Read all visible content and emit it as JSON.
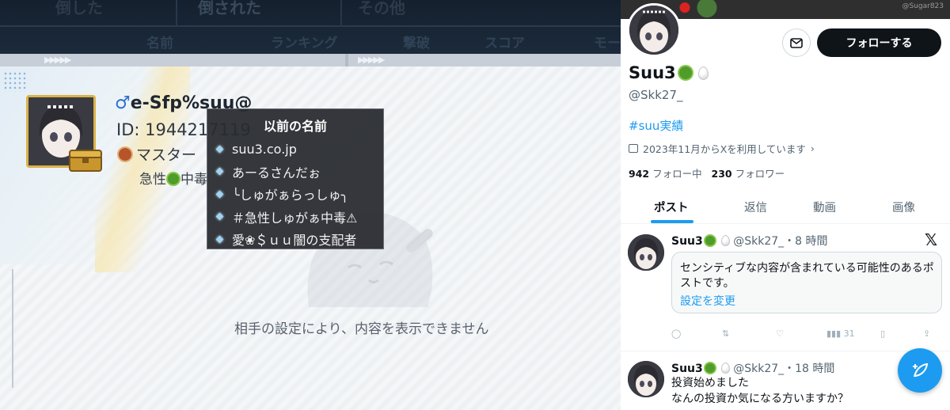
{
  "game": {
    "top_tabs": [
      "倒した",
      "倒された",
      "その他"
    ],
    "columns": [
      "名前",
      "ランキング",
      "撃破",
      "スコア",
      "モー"
    ],
    "player": {
      "name": "e-Sfp%suu@",
      "gender_symbol": "♂",
      "id": "ID: 1944217119",
      "rank": "マスター",
      "status_before": "急性",
      "status_after": "中毒"
    },
    "hidden_message": "相手の設定により、内容を表示できません",
    "tooltip": {
      "title": "以前の名前",
      "items": [
        "suu3.co.jp",
        "あーるさんだぉ",
        "╰しゅがぁらっしゅ╮",
        "＃急性しゅがぁ中毒⚠",
        "愛❀＄ｕｕ闇の支配者"
      ]
    }
  },
  "social": {
    "banner_watermark": "@Sugar823",
    "follow_label": "フォローする",
    "display_name": "Suu3",
    "handle": "@Skk27_",
    "hashtag": "#suu実績",
    "joined": "2023年11月からXを利用しています",
    "following_count": "942",
    "following_label": "フォロー中",
    "followers_count": "230",
    "followers_label": "フォロワー",
    "tabs": [
      "ポスト",
      "返信",
      "動画",
      "画像"
    ],
    "post1": {
      "name": "Suu3",
      "handle": "@Skk27_",
      "time": "・8 時間",
      "sensitive_text": "センシティブな内容が含まれている可能性のあるポストです。",
      "settings_link": "設定を変更",
      "views": "31"
    },
    "post2": {
      "name": "Suu3",
      "handle": "@Skk27_",
      "time": "・18 時間",
      "line1": "投資始めました",
      "line2": "なんの投資か気になる方いますか？"
    }
  },
  "colors": {
    "accent_blue": "#1d9bf0",
    "follow_button": "#0f1419",
    "tooltip_bg": "#2a2c30"
  }
}
